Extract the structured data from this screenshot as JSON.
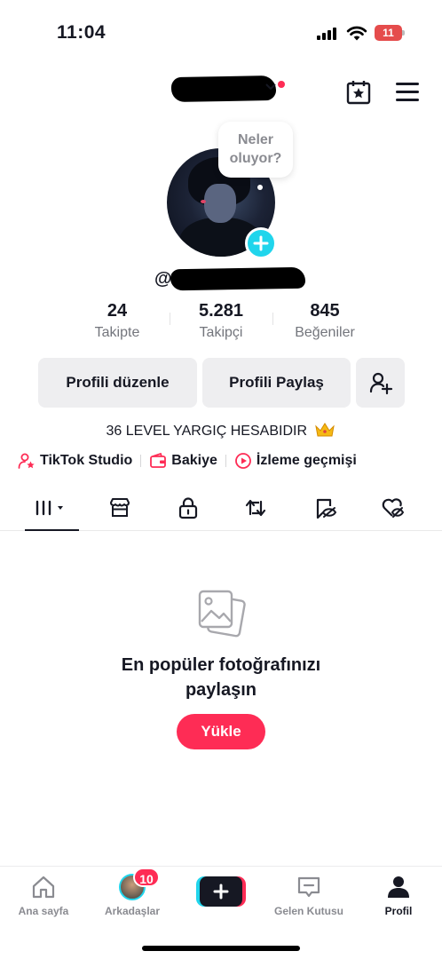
{
  "status_bar": {
    "time": "11:04",
    "battery": "11"
  },
  "profile": {
    "bubble_text": "Neler oluyor?",
    "handle_prefix": "@",
    "stats": [
      {
        "value": "24",
        "label": "Takipte"
      },
      {
        "value": "5.281",
        "label": "Takipçi"
      },
      {
        "value": "845",
        "label": "Beğeniler"
      }
    ],
    "edit_button": "Profili düzenle",
    "share_button": "Profili Paylaş",
    "bio": "36 LEVEL YARGIÇ HESABIDIR"
  },
  "links": [
    {
      "label": "TikTok Studio",
      "icon": "person-star-icon"
    },
    {
      "label": "Bakiye",
      "icon": "wallet-icon"
    },
    {
      "label": "İzleme geçmişi",
      "icon": "play-circle-icon"
    }
  ],
  "tabs": [
    "grid-icon",
    "shop-icon",
    "lock-icon",
    "repost-icon",
    "bookmark-eye-icon",
    "liked-hidden-icon"
  ],
  "empty_state": {
    "title_line1": "En popüler fotoğrafınızı",
    "title_line2": "paylaşın",
    "upload_button": "Yükle"
  },
  "bottom_nav": {
    "home": "Ana sayfa",
    "friends": "Arkadaşlar",
    "friends_badge": "10",
    "inbox": "Gelen Kutusu",
    "profile": "Profil"
  },
  "colors": {
    "accent": "#fe2c55",
    "cyan": "#20d5ec",
    "text": "#161823",
    "muted": "#73757c"
  }
}
